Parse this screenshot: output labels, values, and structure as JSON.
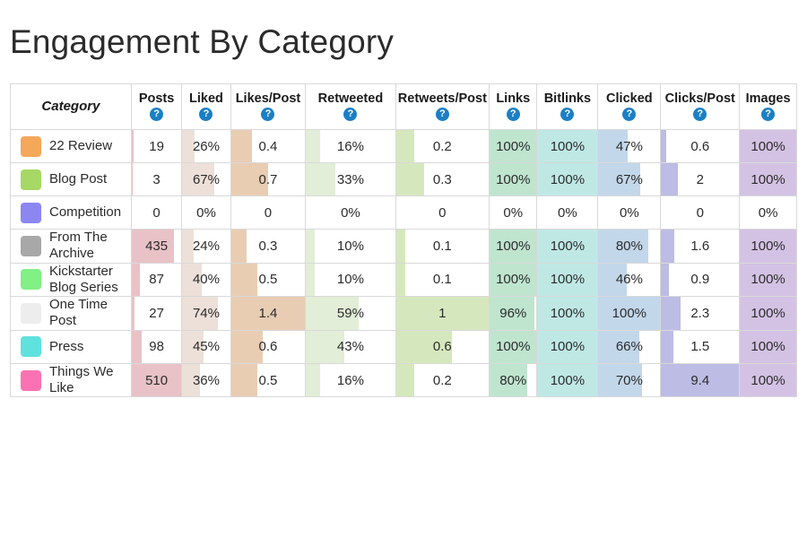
{
  "page": {
    "title": "Engagement By Category"
  },
  "icons": {
    "help": "?",
    "help_icon_name": "help-question-icon"
  },
  "colors": {
    "help_icon_blue": "#1b7fc4",
    "border": "#d9d9d9",
    "text": "#2b2b2b",
    "background": "#ffffff"
  },
  "table": {
    "columns": [
      {
        "key": "category",
        "label": "Category",
        "help": false,
        "bar_color": null,
        "max": null,
        "align": "left"
      },
      {
        "key": "posts",
        "label": "Posts",
        "help": true,
        "bar_color": "#e8c2c6",
        "max": 510,
        "align": "center"
      },
      {
        "key": "liked",
        "label": "Liked",
        "help": true,
        "bar_color": "#ece0d8",
        "max": 100,
        "align": "center"
      },
      {
        "key": "likes_post",
        "label": "Likes/Post",
        "help": true,
        "bar_color": "#e8cdb3",
        "max": 1.4,
        "align": "center"
      },
      {
        "key": "retweeted",
        "label": "Retweeted",
        "help": true,
        "bar_color": "#e2eed7",
        "max": 100,
        "align": "center"
      },
      {
        "key": "retweets_post",
        "label": "Retweets/Post",
        "help": true,
        "bar_color": "#d5e8bd",
        "max": 1,
        "align": "center"
      },
      {
        "key": "links",
        "label": "Links",
        "help": true,
        "bar_color": "#bfe5cf",
        "max": 100,
        "align": "center"
      },
      {
        "key": "bitlinks",
        "label": "Bitlinks",
        "help": true,
        "bar_color": "#bfe8e5",
        "max": 100,
        "align": "center"
      },
      {
        "key": "clicked",
        "label": "Clicked",
        "help": true,
        "bar_color": "#c3d7ea",
        "max": 100,
        "align": "center"
      },
      {
        "key": "clicks_post",
        "label": "Clicks/Post",
        "help": true,
        "bar_color": "#bdbce4",
        "max": 9.4,
        "align": "center"
      },
      {
        "key": "images",
        "label": "Images",
        "help": true,
        "bar_color": "#d4c2e4",
        "max": 100,
        "align": "center"
      }
    ],
    "rows": [
      {
        "swatch": "#f5a75a",
        "category": "22 Review",
        "tall": false,
        "cells": [
          {
            "text": "19",
            "value": 19
          },
          {
            "text": "26%",
            "value": 26
          },
          {
            "text": "0.4",
            "value": 0.4
          },
          {
            "text": "16%",
            "value": 16
          },
          {
            "text": "0.2",
            "value": 0.2
          },
          {
            "text": "100%",
            "value": 100
          },
          {
            "text": "100%",
            "value": 100
          },
          {
            "text": "47%",
            "value": 47
          },
          {
            "text": "0.6",
            "value": 0.6
          },
          {
            "text": "100%",
            "value": 100
          }
        ]
      },
      {
        "swatch": "#a6d866",
        "category": "Blog Post",
        "tall": false,
        "cells": [
          {
            "text": "3",
            "value": 3
          },
          {
            "text": "67%",
            "value": 67
          },
          {
            "text": "0.7",
            "value": 0.7
          },
          {
            "text": "33%",
            "value": 33
          },
          {
            "text": "0.3",
            "value": 0.3
          },
          {
            "text": "100%",
            "value": 100
          },
          {
            "text": "100%",
            "value": 100
          },
          {
            "text": "67%",
            "value": 67
          },
          {
            "text": "2",
            "value": 2
          },
          {
            "text": "100%",
            "value": 100
          }
        ]
      },
      {
        "swatch": "#8b86f2",
        "category": "Competition",
        "tall": false,
        "cells": [
          {
            "text": "0",
            "value": 0
          },
          {
            "text": "0%",
            "value": 0
          },
          {
            "text": "0",
            "value": 0
          },
          {
            "text": "0%",
            "value": 0
          },
          {
            "text": "0",
            "value": 0
          },
          {
            "text": "0%",
            "value": 0
          },
          {
            "text": "0%",
            "value": 0
          },
          {
            "text": "0%",
            "value": 0
          },
          {
            "text": "0",
            "value": 0
          },
          {
            "text": "0%",
            "value": 0
          }
        ]
      },
      {
        "swatch": "#a8a8a8",
        "category": "From The Archive",
        "tall": true,
        "cells": [
          {
            "text": "435",
            "value": 435
          },
          {
            "text": "24%",
            "value": 24
          },
          {
            "text": "0.3",
            "value": 0.3
          },
          {
            "text": "10%",
            "value": 10
          },
          {
            "text": "0.1",
            "value": 0.1
          },
          {
            "text": "100%",
            "value": 100
          },
          {
            "text": "100%",
            "value": 100
          },
          {
            "text": "80%",
            "value": 80
          },
          {
            "text": "1.6",
            "value": 1.6
          },
          {
            "text": "100%",
            "value": 100
          }
        ]
      },
      {
        "swatch": "#81f085",
        "category": "Kickstarter Blog Series",
        "tall": true,
        "cells": [
          {
            "text": "87",
            "value": 87
          },
          {
            "text": "40%",
            "value": 40
          },
          {
            "text": "0.5",
            "value": 0.5
          },
          {
            "text": "10%",
            "value": 10
          },
          {
            "text": "0.1",
            "value": 0.1
          },
          {
            "text": "100%",
            "value": 100
          },
          {
            "text": "100%",
            "value": 100
          },
          {
            "text": "46%",
            "value": 46
          },
          {
            "text": "0.9",
            "value": 0.9
          },
          {
            "text": "100%",
            "value": 100
          }
        ]
      },
      {
        "swatch": "#ededed",
        "category": "One Time Post",
        "tall": true,
        "cells": [
          {
            "text": "27",
            "value": 27
          },
          {
            "text": "74%",
            "value": 74
          },
          {
            "text": "1.4",
            "value": 1.4
          },
          {
            "text": "59%",
            "value": 59
          },
          {
            "text": "1",
            "value": 1
          },
          {
            "text": "96%",
            "value": 96
          },
          {
            "text": "100%",
            "value": 100
          },
          {
            "text": "100%",
            "value": 100
          },
          {
            "text": "2.3",
            "value": 2.3
          },
          {
            "text": "100%",
            "value": 100
          }
        ]
      },
      {
        "swatch": "#5fe1dd",
        "category": "Press",
        "tall": false,
        "cells": [
          {
            "text": "98",
            "value": 98
          },
          {
            "text": "45%",
            "value": 45
          },
          {
            "text": "0.6",
            "value": 0.6
          },
          {
            "text": "43%",
            "value": 43
          },
          {
            "text": "0.6",
            "value": 0.6
          },
          {
            "text": "100%",
            "value": 100
          },
          {
            "text": "100%",
            "value": 100
          },
          {
            "text": "66%",
            "value": 66
          },
          {
            "text": "1.5",
            "value": 1.5
          },
          {
            "text": "100%",
            "value": 100
          }
        ]
      },
      {
        "swatch": "#fb72b2",
        "category": "Things We Like",
        "tall": true,
        "cells": [
          {
            "text": "510",
            "value": 510
          },
          {
            "text": "36%",
            "value": 36
          },
          {
            "text": "0.5",
            "value": 0.5
          },
          {
            "text": "16%",
            "value": 16
          },
          {
            "text": "0.2",
            "value": 0.2
          },
          {
            "text": "80%",
            "value": 80
          },
          {
            "text": "100%",
            "value": 100
          },
          {
            "text": "70%",
            "value": 70
          },
          {
            "text": "9.4",
            "value": 9.4
          },
          {
            "text": "100%",
            "value": 100
          }
        ]
      }
    ]
  }
}
